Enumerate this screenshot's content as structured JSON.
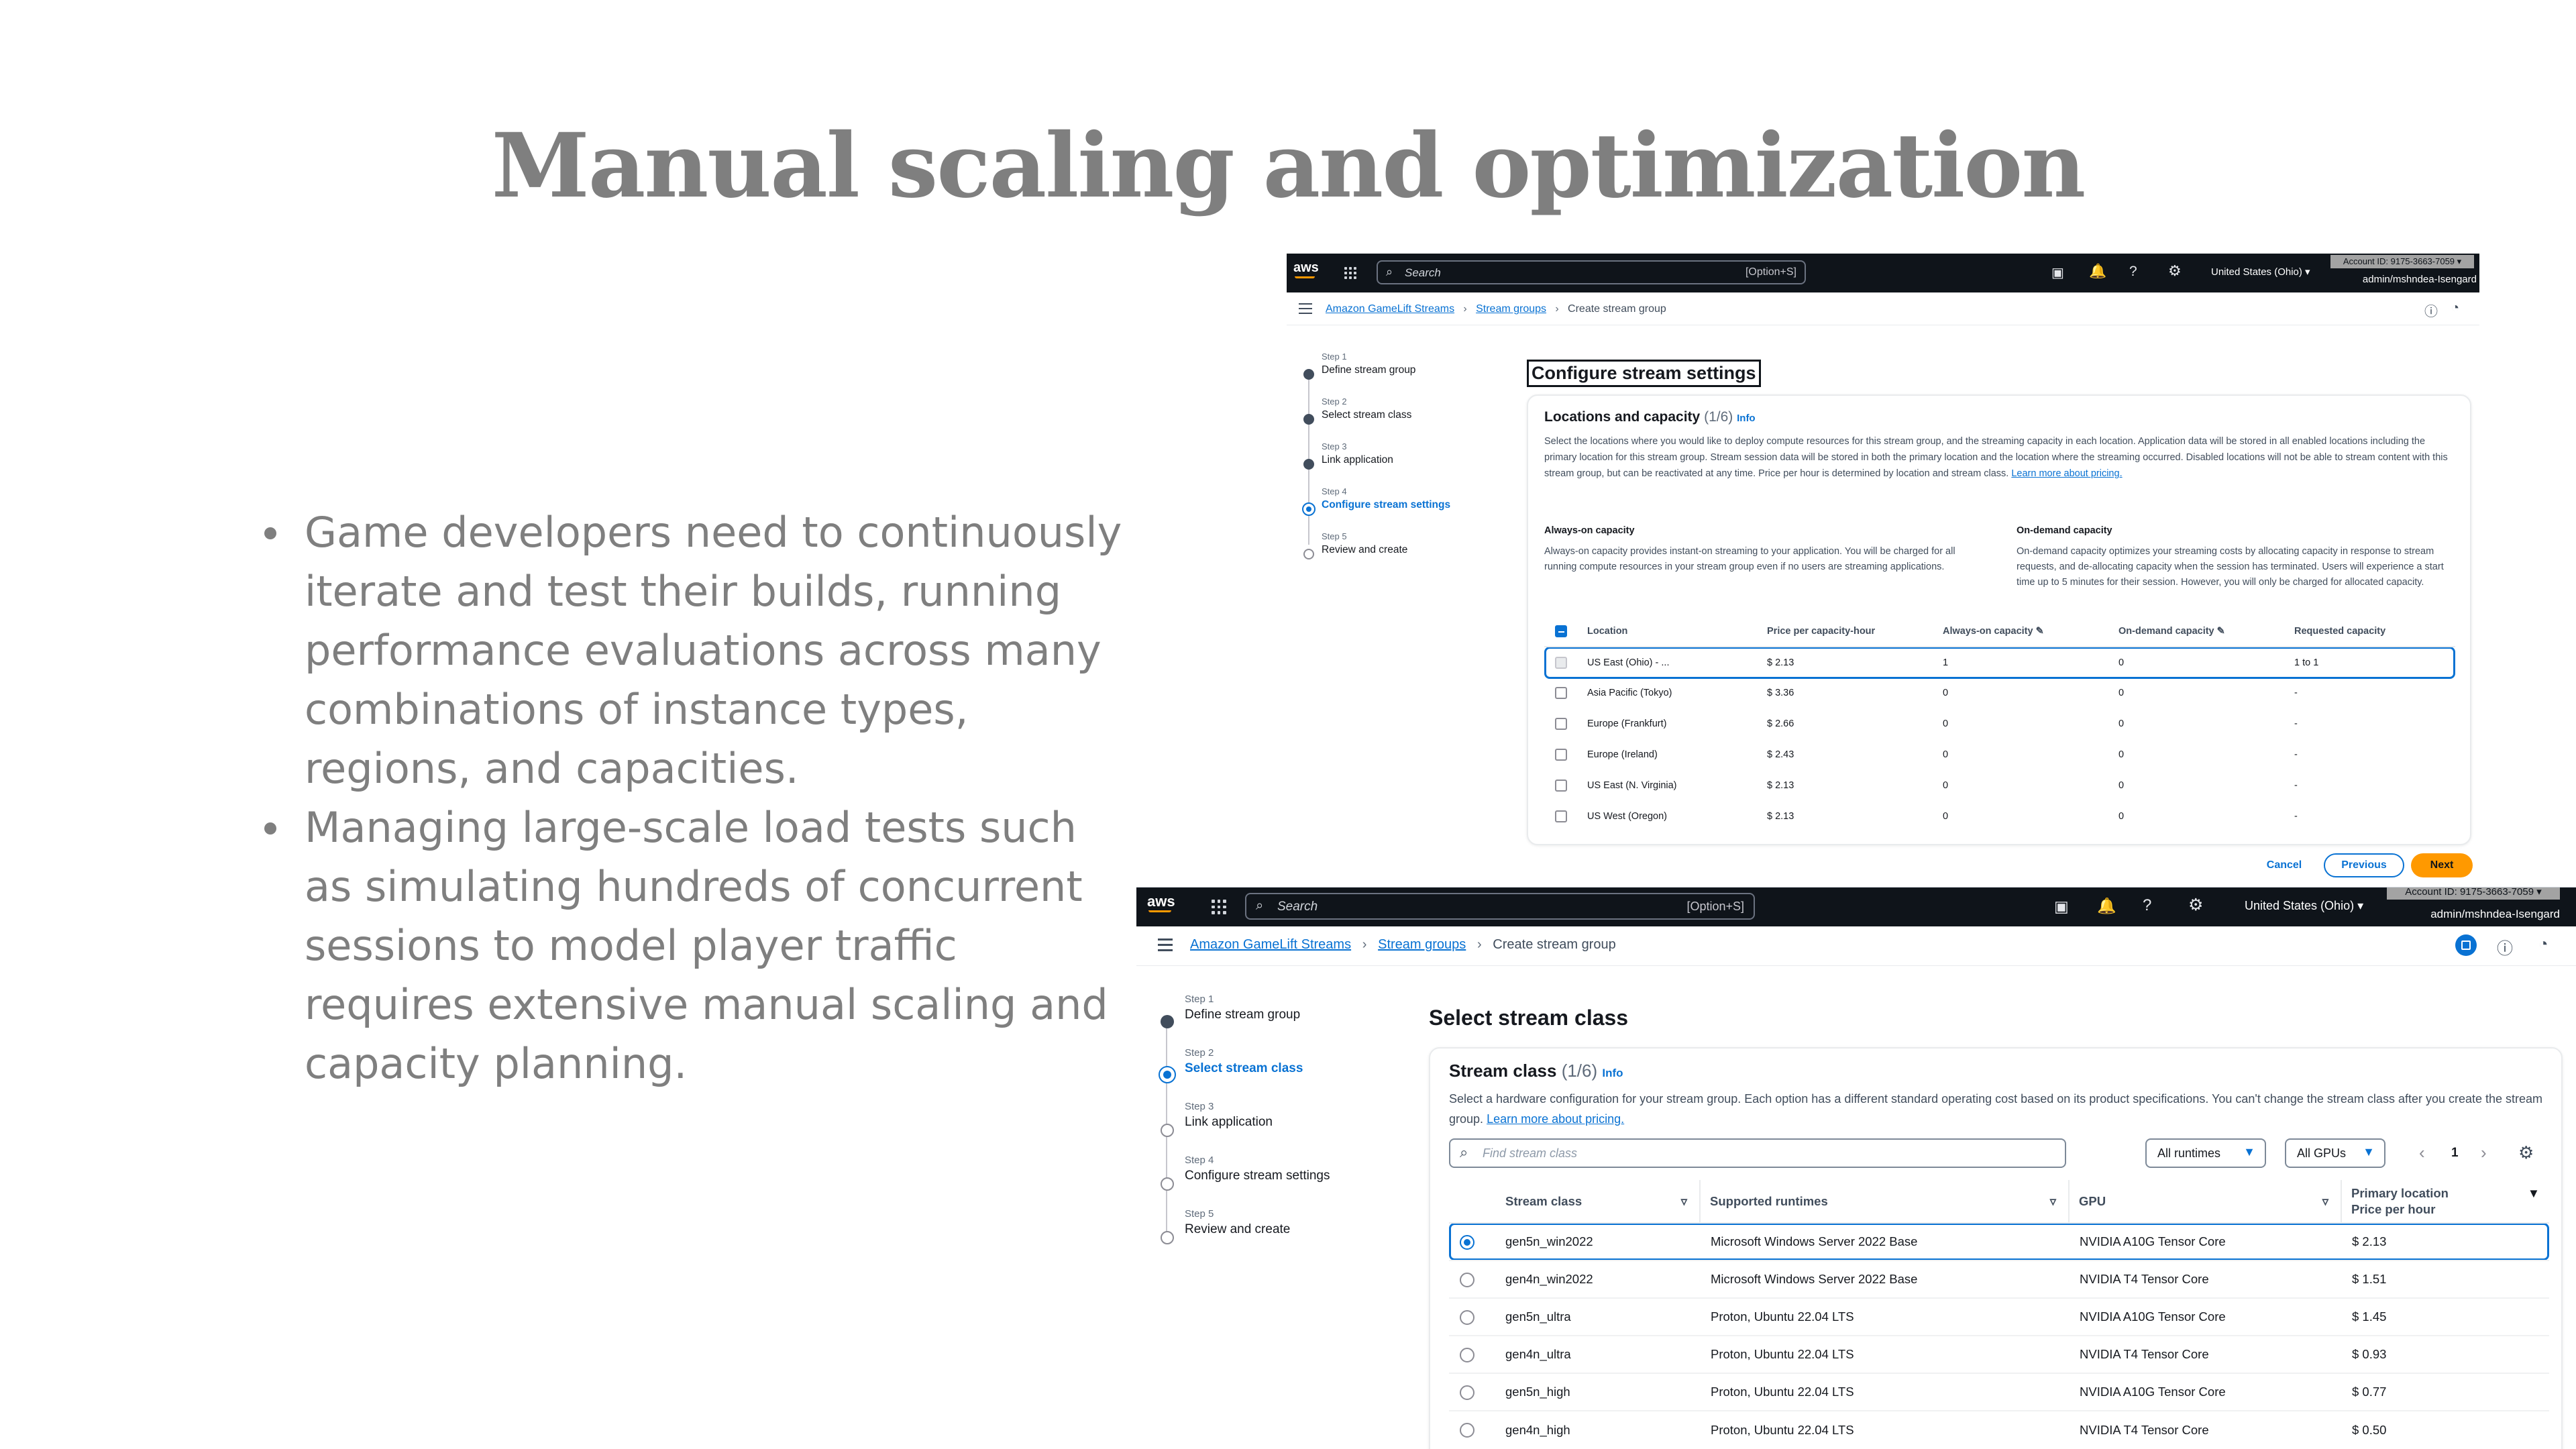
{
  "slide": {
    "title": "Manual scaling and optimization",
    "bullets": [
      "Game developers need to continuously iterate and test their builds, running performance evaluations across many combinations of instance types, regions, and capacities.",
      "Managing large-scale load tests such as simulating hundreds of concurrent sessions to model player traffic requires extensive manual scaling and capacity planning."
    ]
  },
  "top_console": {
    "nav": {
      "logo": "aws",
      "search_placeholder": "Search",
      "search_shortcut": "[Option+S]",
      "region": "United States (Ohio) ▾",
      "account_id": "Account ID: 9175-3663-7059 ▾",
      "user": "admin/mshndea-Isengard"
    },
    "breadcrumbs": [
      "Amazon GameLift Streams",
      "Stream groups",
      "Create stream group"
    ],
    "steps": [
      {
        "label": "Step 1",
        "name": "Define stream group",
        "state": "done"
      },
      {
        "label": "Step 2",
        "name": "Select stream class",
        "state": "done"
      },
      {
        "label": "Step 3",
        "name": "Link application",
        "state": "done"
      },
      {
        "label": "Step 4",
        "name": "Configure stream settings",
        "state": "active"
      },
      {
        "label": "Step 5",
        "name": "Review and create",
        "state": "todo"
      }
    ],
    "page_title": "Configure stream settings",
    "card_title": "Locations and capacity",
    "card_count": "(1/6)",
    "info": "Info",
    "description": "Select the locations where you would like to deploy compute resources for this stream group, and the streaming capacity in each location. Application data will be stored in all enabled locations including the primary location for this stream group. Stream session data will be stored in both the primary location and the location where the streaming occurred. Disabled locations will not be able to stream content with this stream group, but can be reactivated at any time. Price per hour is determined by location and stream class.",
    "learn_more": "Learn more about pricing.",
    "always_on": {
      "title": "Always-on capacity",
      "text": "Always-on capacity provides instant-on streaming to your application. You will be charged for all running compute resources in your stream group even if no users are streaming applications."
    },
    "on_demand": {
      "title": "On-demand capacity",
      "text": "On-demand capacity optimizes your streaming costs by allocating capacity in response to stream requests, and de-allocating capacity when the session has terminated. Users will experience a start time up to 5 minutes for their session. However, you will only be charged for allocated capacity."
    },
    "table": {
      "headers": [
        "Location",
        "Price per capacity-hour",
        "Always-on capacity ✎",
        "On-demand capacity ✎",
        "Requested capacity"
      ],
      "rows": [
        [
          "US East (Ohio) - ...",
          "$ 2.13",
          "1",
          "0",
          "1 to 1"
        ],
        [
          "Asia Pacific (Tokyo)",
          "$ 3.36",
          "0",
          "0",
          "-"
        ],
        [
          "Europe (Frankfurt)",
          "$ 2.66",
          "0",
          "0",
          "-"
        ],
        [
          "Europe (Ireland)",
          "$ 2.43",
          "0",
          "0",
          "-"
        ],
        [
          "US East (N. Virginia)",
          "$ 2.13",
          "0",
          "0",
          "-"
        ],
        [
          "US West (Oregon)",
          "$ 2.13",
          "0",
          "0",
          "-"
        ]
      ]
    },
    "buttons": {
      "cancel": "Cancel",
      "previous": "Previous",
      "next": "Next"
    }
  },
  "bottom_console": {
    "nav": {
      "logo": "aws",
      "search_placeholder": "Search",
      "search_shortcut": "[Option+S]",
      "region": "United States (Ohio) ▾",
      "account_id": "Account ID: 9175-3663-7059 ▾",
      "user": "admin/mshndea-Isengard"
    },
    "breadcrumbs": [
      "Amazon GameLift Streams",
      "Stream groups",
      "Create stream group"
    ],
    "steps": [
      {
        "label": "Step 1",
        "name": "Define stream group",
        "state": "done"
      },
      {
        "label": "Step 2",
        "name": "Select stream class",
        "state": "active"
      },
      {
        "label": "Step 3",
        "name": "Link application",
        "state": "todo"
      },
      {
        "label": "Step 4",
        "name": "Configure stream settings",
        "state": "todo"
      },
      {
        "label": "Step 5",
        "name": "Review and create",
        "state": "todo"
      }
    ],
    "page_title": "Select stream class",
    "card_title": "Stream class",
    "card_count": "(1/6)",
    "info": "Info",
    "description": "Select a hardware configuration for your stream group. Each option has a different standard operating cost based on its product specifications. You can't change the stream class after you create the stream group.",
    "learn_more": "Learn more about pricing.",
    "filter_placeholder": "Find stream class",
    "runtime_filter": "All runtimes",
    "gpu_filter": "All GPUs",
    "page_number": "1",
    "table": {
      "headers": [
        "Stream class",
        "Supported runtimes",
        "GPU",
        "Primary location",
        "Price per hour"
      ],
      "rows": [
        [
          "gen5n_win2022",
          "Microsoft Windows Server 2022 Base",
          "NVIDIA A10G Tensor Core",
          "$ 2.13"
        ],
        [
          "gen4n_win2022",
          "Microsoft Windows Server 2022 Base",
          "NVIDIA T4 Tensor Core",
          "$ 1.51"
        ],
        [
          "gen5n_ultra",
          "Proton, Ubuntu 22.04 LTS",
          "NVIDIA A10G Tensor Core",
          "$ 1.45"
        ],
        [
          "gen4n_ultra",
          "Proton, Ubuntu 22.04 LTS",
          "NVIDIA T4 Tensor Core",
          "$ 0.93"
        ],
        [
          "gen5n_high",
          "Proton, Ubuntu 22.04 LTS",
          "NVIDIA A10G Tensor Core",
          "$ 0.77"
        ],
        [
          "gen4n_high",
          "Proton, Ubuntu 22.04 LTS",
          "NVIDIA T4 Tensor Core",
          "$ 0.50"
        ]
      ]
    }
  }
}
